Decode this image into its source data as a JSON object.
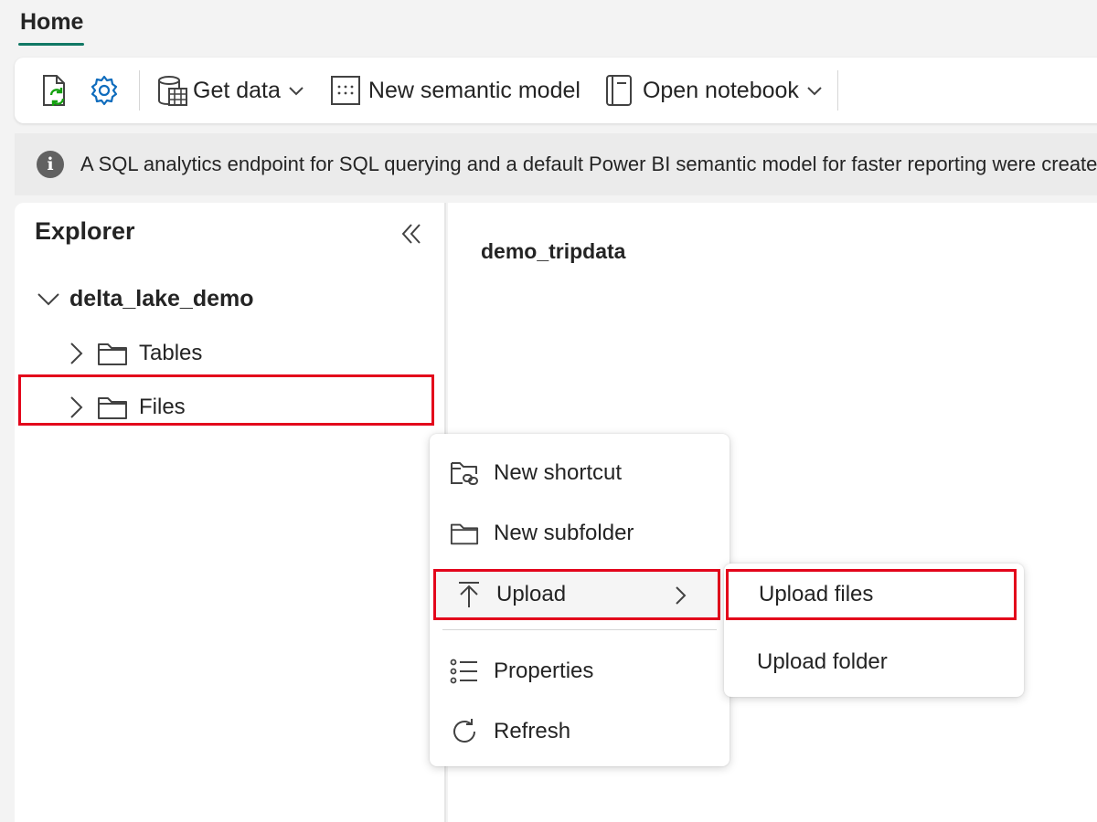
{
  "tab": {
    "label": "Home"
  },
  "toolbar": {
    "icons": [
      "refresh-document-icon",
      "settings-gear-icon"
    ],
    "get_data_label": "Get data",
    "new_semantic_model_label": "New semantic model",
    "open_notebook_label": "Open notebook"
  },
  "banner": {
    "icon": "info-icon",
    "text": "A SQL analytics endpoint for SQL querying and a default Power BI semantic model for faster reporting were created"
  },
  "explorer": {
    "title": "Explorer",
    "root": {
      "label": "delta_lake_demo",
      "expanded": true
    },
    "items": [
      {
        "label": "Tables",
        "icon": "folder-icon",
        "expanded": false
      },
      {
        "label": "Files",
        "icon": "folder-icon",
        "expanded": false,
        "highlighted": true
      }
    ]
  },
  "main": {
    "title": "demo_tripdata"
  },
  "context_menu": {
    "items": [
      {
        "label": "New shortcut",
        "icon": "folder-link-icon"
      },
      {
        "label": "New subfolder",
        "icon": "folder-icon"
      },
      {
        "label": "Upload",
        "icon": "upload-arrow-icon",
        "has_submenu": true,
        "highlighted": true
      },
      {
        "label": "Properties",
        "icon": "list-icon"
      },
      {
        "label": "Refresh",
        "icon": "refresh-icon"
      }
    ]
  },
  "submenu": {
    "items": [
      {
        "label": "Upload files",
        "highlighted": true
      },
      {
        "label": "Upload folder"
      }
    ]
  },
  "colors": {
    "accent": "#117865",
    "highlight": "#e3051b",
    "refresh_green": "#13a10e",
    "gear_blue": "#0f6cbd"
  }
}
